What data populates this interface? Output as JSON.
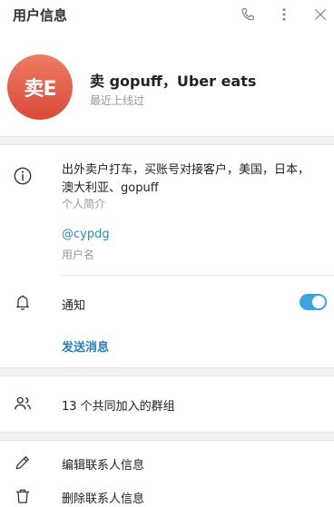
{
  "header": {
    "title": "用户信息",
    "icons": [
      "phone-icon",
      "more-vertical-icon",
      "close-icon"
    ]
  },
  "profile": {
    "avatar_text": "卖E",
    "avatar_color_top": "#ef7b64",
    "avatar_color_bottom": "#d9493a",
    "name": "卖 gopuff，Uber eats",
    "status": "最近上线过"
  },
  "info": {
    "bio_line1": "出外卖户打车，买账号对接客户，美国，日本，",
    "bio_line2": "澳大利亚、gopuff",
    "bio_label": "个人简介",
    "username": "@cypdg",
    "username_label": "用户名"
  },
  "notifications": {
    "label": "通知",
    "enabled": true
  },
  "actions": {
    "send_message": "发送消息",
    "common_groups": "13 个共同加入的群组",
    "edit_contact": "编辑联系人信息",
    "delete_contact": "删除联系人信息"
  },
  "colors": {
    "accent": "#2b8ac7",
    "toggle_on": "#3ba4e2"
  }
}
